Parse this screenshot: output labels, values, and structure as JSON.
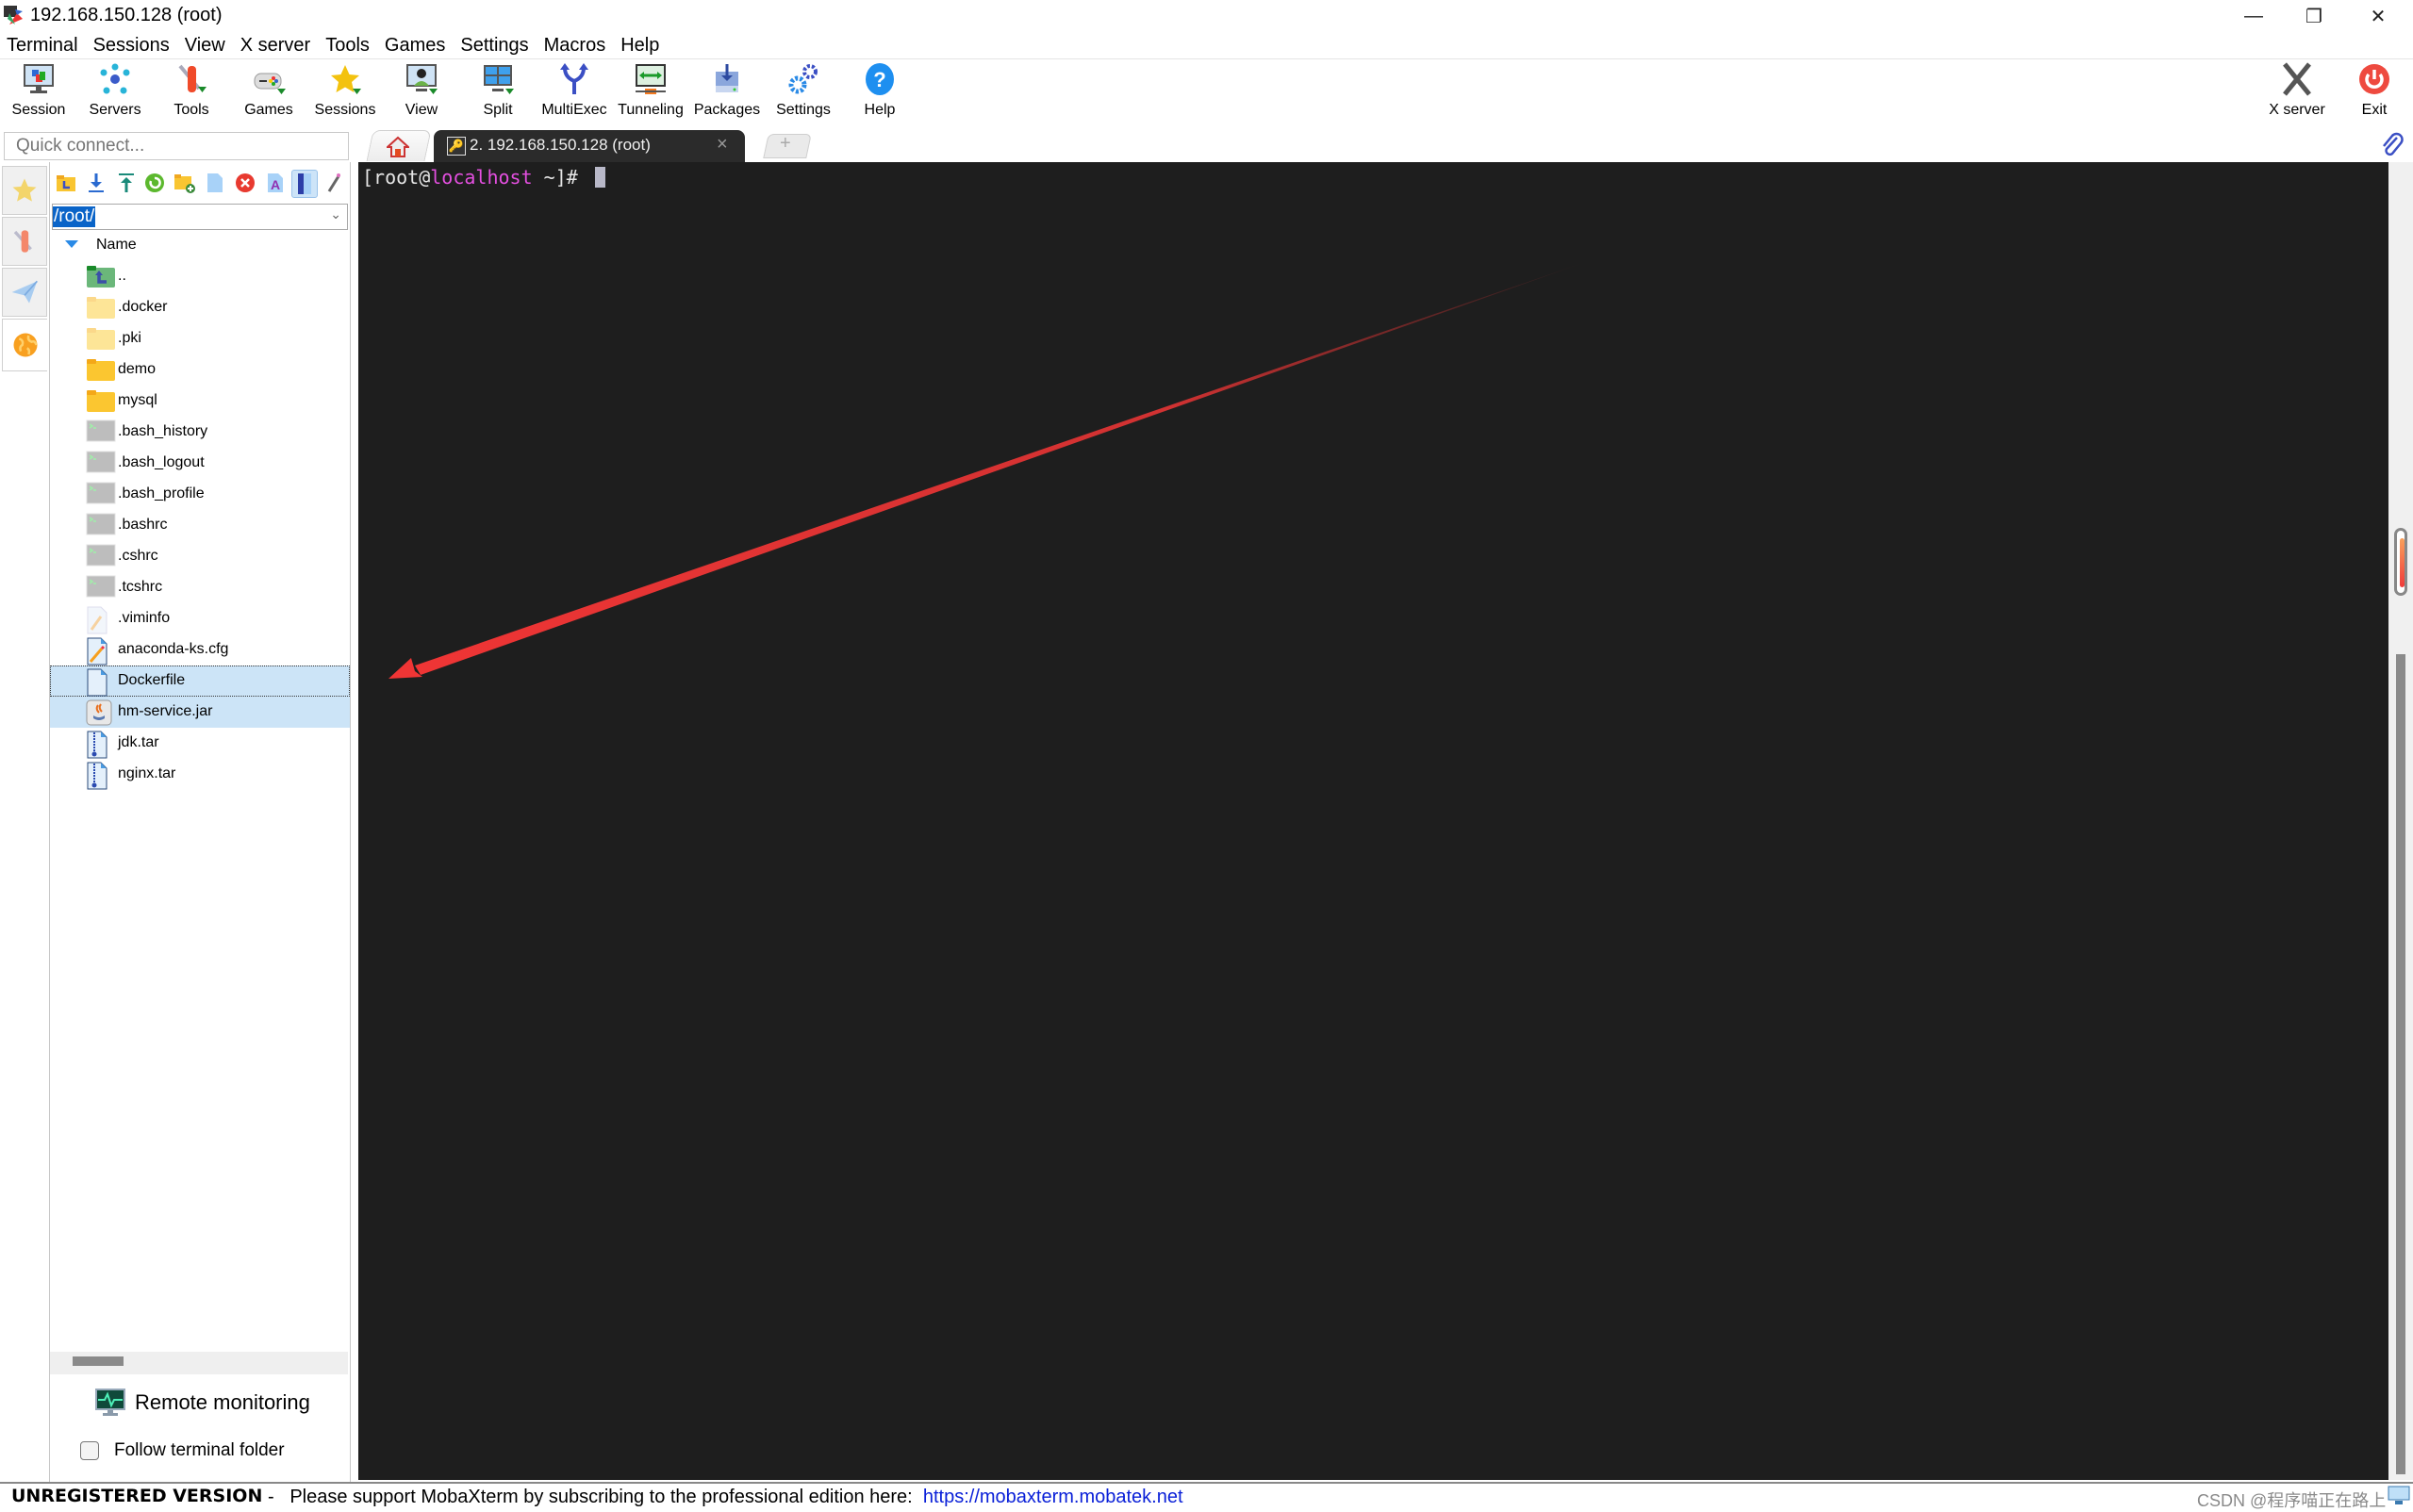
{
  "window": {
    "title": "192.168.150.128 (root)",
    "controls": {
      "minimize": "—",
      "restore": "❐",
      "close": "✕"
    }
  },
  "menu": [
    "Terminal",
    "Sessions",
    "View",
    "X server",
    "Tools",
    "Games",
    "Settings",
    "Macros",
    "Help"
  ],
  "toolbar": {
    "left": [
      {
        "label": "Session",
        "icon": "session-icon"
      },
      {
        "label": "Servers",
        "icon": "servers-icon"
      },
      {
        "label": "Tools",
        "icon": "tools-icon"
      },
      {
        "label": "Games",
        "icon": "games-icon"
      },
      {
        "label": "Sessions",
        "icon": "star-icon"
      },
      {
        "label": "View",
        "icon": "view-icon"
      },
      {
        "label": "Split",
        "icon": "split-icon"
      },
      {
        "label": "MultiExec",
        "icon": "multiexec-icon"
      },
      {
        "label": "Tunneling",
        "icon": "tunneling-icon"
      },
      {
        "label": "Packages",
        "icon": "packages-icon"
      },
      {
        "label": "Settings",
        "icon": "settings-icon"
      },
      {
        "label": "Help",
        "icon": "help-icon"
      }
    ],
    "right": [
      {
        "label": "X server",
        "icon": "x-server-icon"
      },
      {
        "label": "Exit",
        "icon": "power-icon"
      }
    ]
  },
  "quick_connect": {
    "placeholder": "Quick connect..."
  },
  "tabs": {
    "home_icon": "home-icon",
    "active": {
      "label": "2. 192.168.150.128 (root)",
      "close": "×"
    },
    "new_tab": "+"
  },
  "file_browser": {
    "path": "/root/",
    "column_header": "Name",
    "files": [
      {
        "name": "..",
        "type": "parent"
      },
      {
        "name": ".docker",
        "type": "folder-hidden"
      },
      {
        "name": ".pki",
        "type": "folder-hidden"
      },
      {
        "name": "demo",
        "type": "folder"
      },
      {
        "name": "mysql",
        "type": "folder"
      },
      {
        "name": ".bash_history",
        "type": "shell"
      },
      {
        "name": ".bash_logout",
        "type": "shell"
      },
      {
        "name": ".bash_profile",
        "type": "shell"
      },
      {
        "name": ".bashrc",
        "type": "shell"
      },
      {
        "name": ".cshrc",
        "type": "shell"
      },
      {
        "name": ".tcshrc",
        "type": "shell"
      },
      {
        "name": ".viminfo",
        "type": "text-hidden"
      },
      {
        "name": "anaconda-ks.cfg",
        "type": "text"
      },
      {
        "name": "Dockerfile",
        "type": "blank",
        "state": "focused-selected"
      },
      {
        "name": "hm-service.jar",
        "type": "jar",
        "state": "selected"
      },
      {
        "name": "jdk.tar",
        "type": "archive"
      },
      {
        "name": "nginx.tar",
        "type": "archive"
      }
    ],
    "remote_monitoring": "Remote monitoring",
    "follow_terminal_folder": {
      "label": "Follow terminal folder",
      "checked": false
    }
  },
  "terminal": {
    "prompt_open": "[root@",
    "prompt_host": "localhost",
    "prompt_close": " ~]# "
  },
  "status_bar": {
    "unregistered": "UNREGISTERED VERSION",
    "separator": " - ",
    "message": "Please support MobaXterm by subscribing to the professional edition here:",
    "link": "https://mobaxterm.mobatek.net",
    "watermark": "CSDN @程序喵正在路上"
  },
  "annotation": {
    "type": "red arrow",
    "color": "#f03535",
    "points_to": "Dockerfile"
  },
  "colors": {
    "terminal_bg": "#1e1e1e",
    "prompt_host": "#e44fe0",
    "selection": "#cce4f7",
    "link": "#0a20d8"
  }
}
